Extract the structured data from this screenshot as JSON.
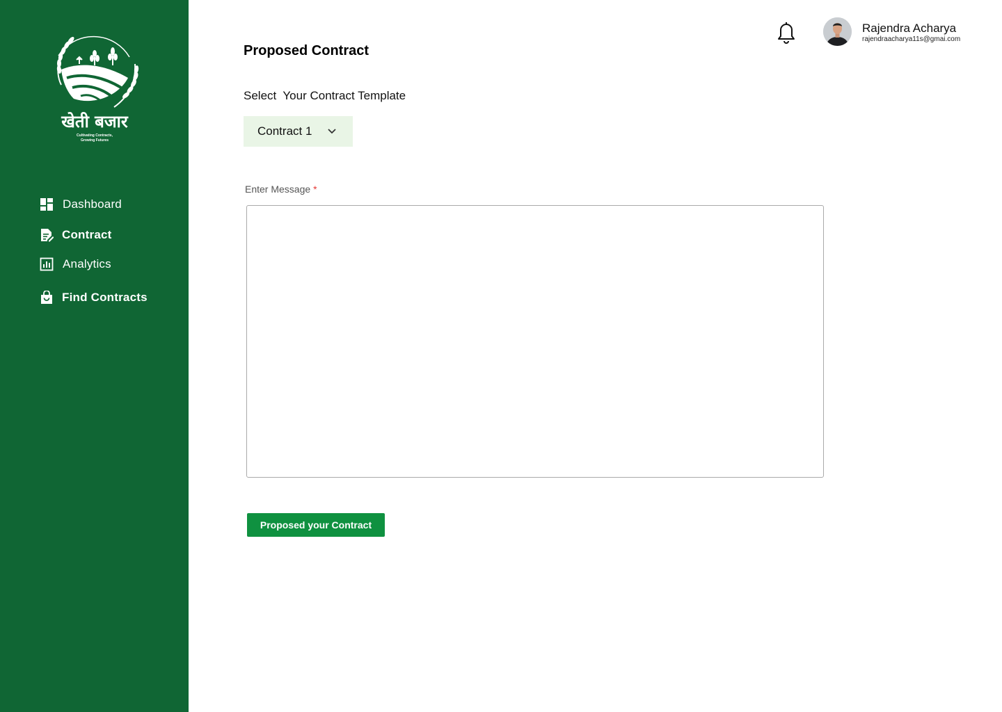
{
  "brand": {
    "name": "खेती बजार",
    "tagline_line1": "Cultivating Contracts,",
    "tagline_line2": "Growing Futures"
  },
  "sidebar": {
    "items": [
      {
        "label": "Dashboard",
        "icon": "dashboard-icon"
      },
      {
        "label": "Contract",
        "icon": "contract-icon"
      },
      {
        "label": "Analytics",
        "icon": "analytics-icon"
      },
      {
        "label": "Find Contracts",
        "icon": "shopping-bag-icon"
      }
    ]
  },
  "header": {
    "user_name": "Rajendra Acharya",
    "user_email": "rajendraacharya11s@gmai.com"
  },
  "main": {
    "title": "Proposed Contract",
    "template_label": "Select  Your Contract Template",
    "template_selected": "Contract 1",
    "message_label": "Enter Message",
    "required_marker": "*",
    "message_value": "",
    "submit_label": "Proposed your Contract"
  },
  "colors": {
    "sidebar_bg": "#106634",
    "button_bg": "#0f9140",
    "dropdown_bg": "#e9f5e6",
    "required": "#e53935"
  }
}
